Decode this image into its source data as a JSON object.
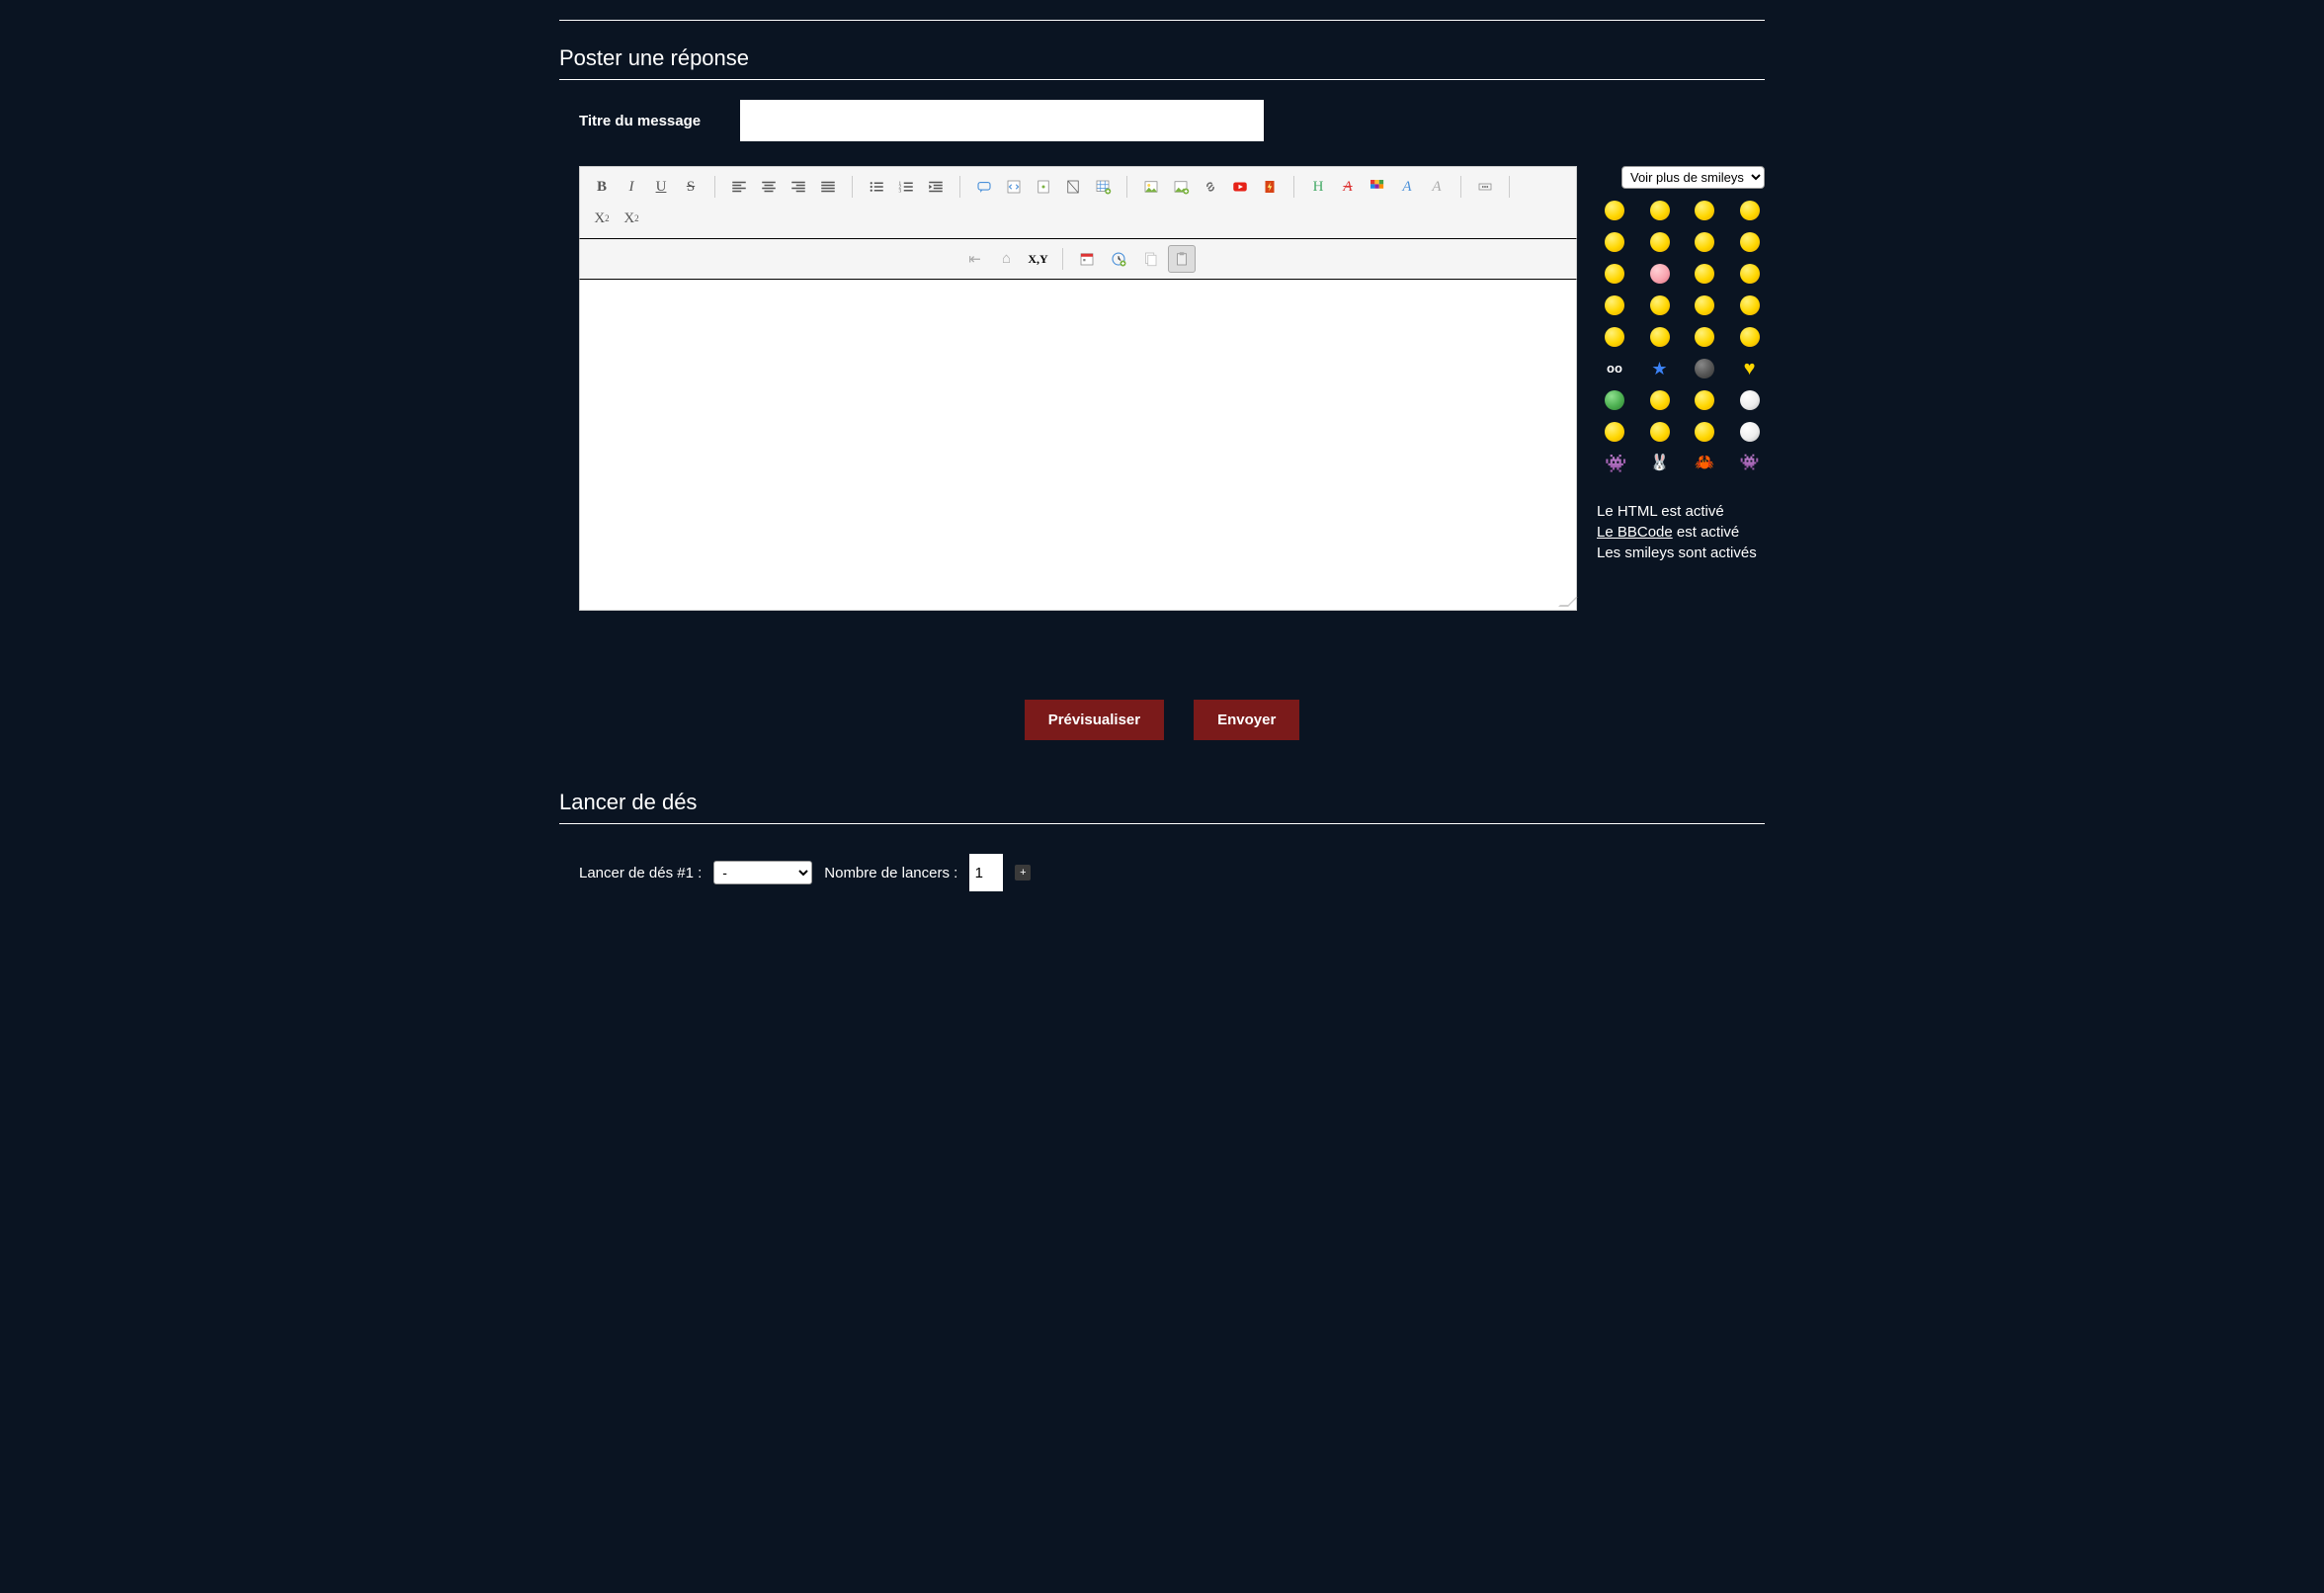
{
  "section": {
    "post_title_heading": "Poster une réponse",
    "dice_heading": "Lancer de dés"
  },
  "form": {
    "title_label": "Titre du message",
    "title_value": ""
  },
  "smileys": {
    "more_label": "Voir plus de smileys"
  },
  "status": {
    "html": "Le HTML est activé",
    "bbcode_link": "Le BBCode",
    "bbcode_suffix": " est activé",
    "smileys": "Les smileys sont activés"
  },
  "buttons": {
    "preview": "Prévisualiser",
    "send": "Envoyer"
  },
  "dice": {
    "label1": "Lancer de dés #1 :",
    "select_value": "-",
    "throws_label": "Nombre de lancers :",
    "throws_value": "1"
  },
  "toolbar_icons": [
    "bold",
    "italic",
    "underline",
    "strike",
    "sep",
    "align-left",
    "align-center",
    "align-right",
    "align-justify",
    "sep",
    "ulist",
    "olist",
    "outdent",
    "sep",
    "quote",
    "code",
    "spoiler",
    "hide",
    "table",
    "sep",
    "image",
    "host",
    "link",
    "youtube",
    "flash",
    "sep",
    "header",
    "remove-format",
    "palette",
    "font",
    "font-size",
    "sep",
    "more",
    "sep",
    "subscript",
    "superscript"
  ],
  "toolbar_row2": [
    "rewind",
    "up",
    "randxy",
    "sep",
    "date",
    "time",
    "copy",
    "paste"
  ]
}
